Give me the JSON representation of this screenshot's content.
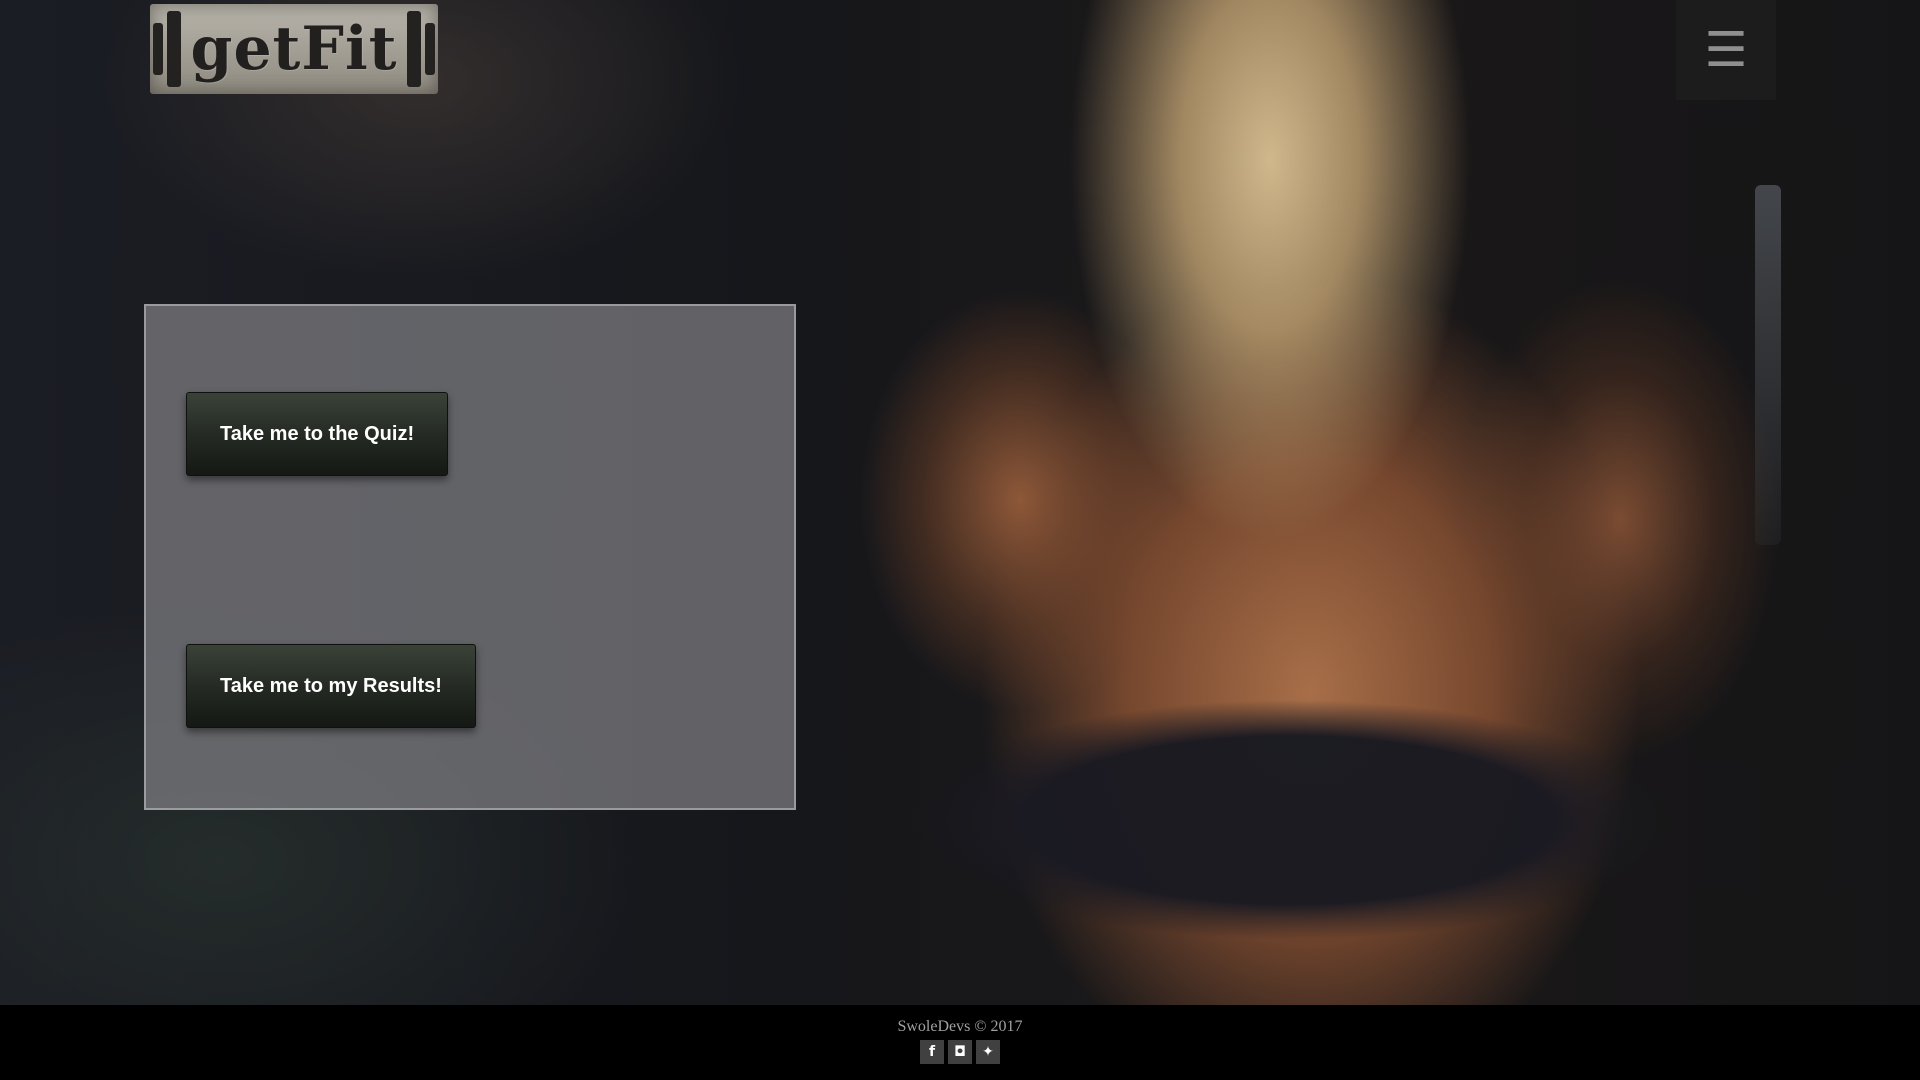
{
  "header": {
    "logo_text": "getFit",
    "menu_icon": "hamburger-icon",
    "menu_glyph": "☰"
  },
  "main": {
    "quiz_button_label": "Take me to the Quiz!",
    "results_button_label": "Take me to my Results!"
  },
  "footer": {
    "copyright": "SwoleDevs © 2017",
    "social": [
      {
        "name": "facebook-icon",
        "glyph": "f"
      },
      {
        "name": "instagram-icon",
        "glyph": "◘"
      },
      {
        "name": "twitter-icon",
        "glyph": "✦"
      }
    ]
  },
  "colors": {
    "button_bg": "#232922",
    "footer_bg": "#000000",
    "panel_bg": "#808084"
  }
}
